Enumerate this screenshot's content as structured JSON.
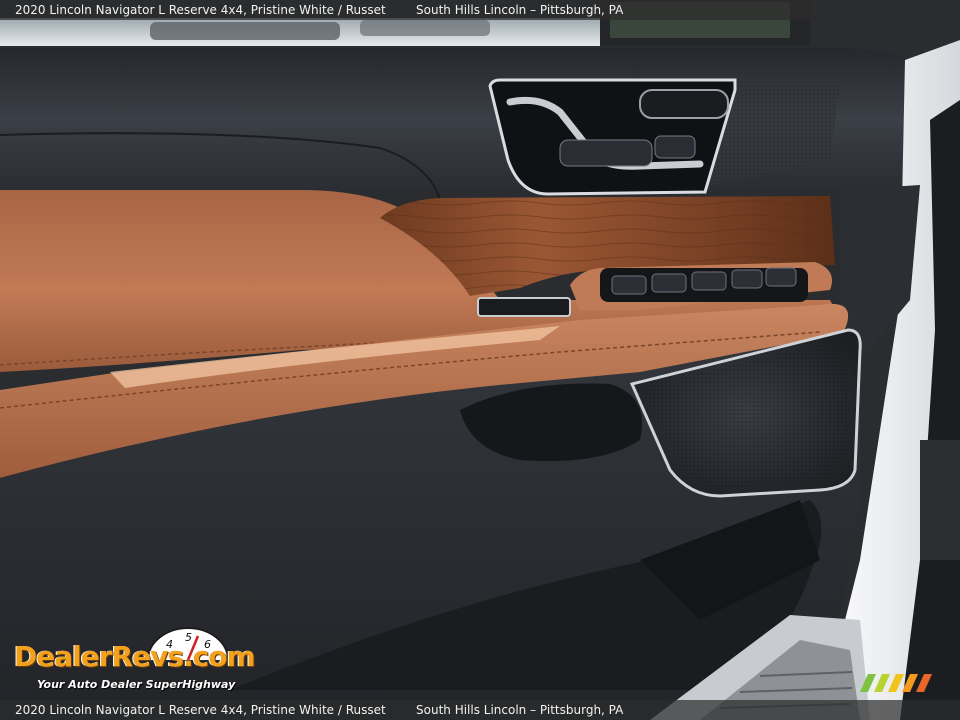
{
  "caption": {
    "vehicle": "2020 Lincoln Navigator L Reserve 4x4,  Pristine White / Russet",
    "dealer": "South Hills Lincoln – Pittsburgh, PA"
  },
  "watermark": {
    "brand": "DealerRevs.com",
    "tagline": "Your Auto Dealer SuperHighway",
    "gauge_digits": [
      "4",
      "5",
      "6"
    ]
  },
  "colors": {
    "russet_leather": "#b86e4a",
    "wood_trim": "#8a4a2a",
    "dark_panel": "#2d3036",
    "chrome": "#c9ccd1",
    "body_white": "#eef0f2",
    "logo_orange": "#f2a11f",
    "logo_blue": "#2a8fd6"
  },
  "icons": [
    "seat-memory-control-icon",
    "window-switch-icon",
    "door-handle-icon",
    "speaker-grille-icon"
  ]
}
